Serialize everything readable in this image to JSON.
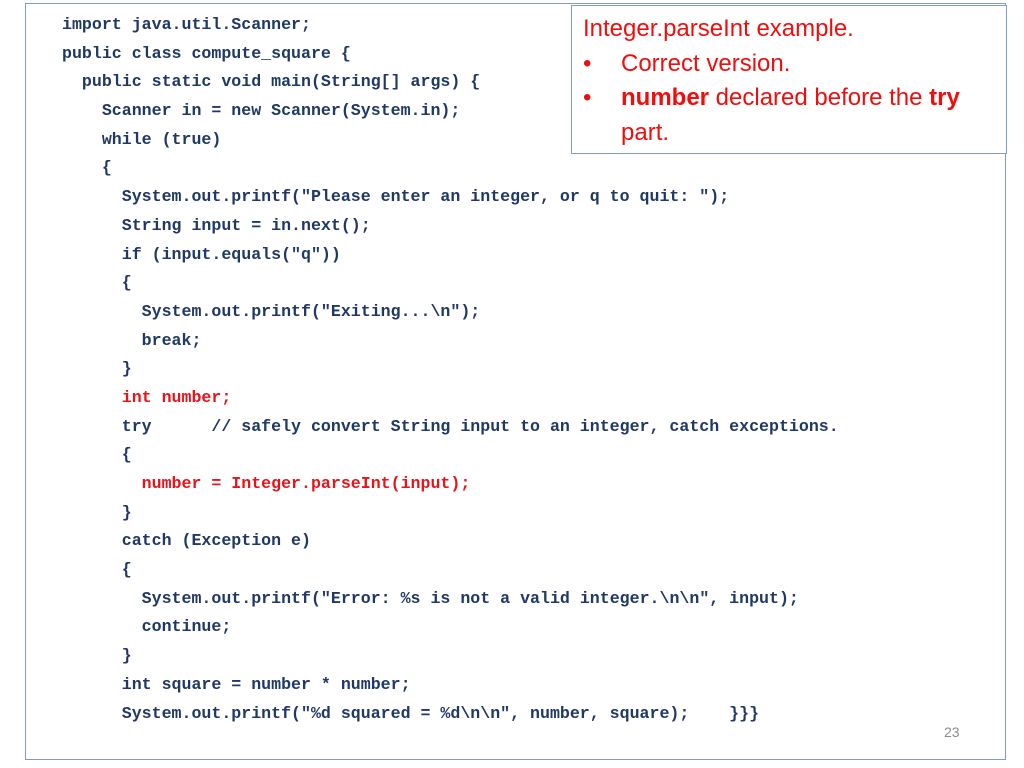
{
  "code": {
    "lines": [
      {
        "indent": "",
        "text": "import java.util.Scanner;",
        "highlight": false
      },
      {
        "indent": "",
        "text": "public class compute_square {",
        "highlight": false
      },
      {
        "indent": "  ",
        "text": "public static void main(String[] args) {",
        "highlight": false
      },
      {
        "indent": "    ",
        "text": "Scanner in = new Scanner(System.in);",
        "highlight": false
      },
      {
        "indent": "    ",
        "text": "while (true)",
        "highlight": false
      },
      {
        "indent": "    ",
        "text": "{",
        "highlight": false
      },
      {
        "indent": "      ",
        "text": "System.out.printf(\"Please enter an integer, or q to quit: \");",
        "highlight": false
      },
      {
        "indent": "      ",
        "text": "String input = in.next();",
        "highlight": false
      },
      {
        "indent": "      ",
        "text": "if (input.equals(\"q\"))",
        "highlight": false
      },
      {
        "indent": "      ",
        "text": "{",
        "highlight": false
      },
      {
        "indent": "        ",
        "text": "System.out.printf(\"Exiting...\\n\");",
        "highlight": false
      },
      {
        "indent": "        ",
        "text": "break;",
        "highlight": false
      },
      {
        "indent": "      ",
        "text": "}",
        "highlight": false
      },
      {
        "indent": "      ",
        "text": "int number;",
        "highlight": true
      },
      {
        "indent": "      ",
        "text": "try      // safely convert String input to an integer, catch exceptions.",
        "highlight": false
      },
      {
        "indent": "      ",
        "text": "{",
        "highlight": false
      },
      {
        "indent": "        ",
        "text": "number = Integer.parseInt(input);",
        "highlight": true
      },
      {
        "indent": "      ",
        "text": "}",
        "highlight": false
      },
      {
        "indent": "      ",
        "text": "catch (Exception e)",
        "highlight": false
      },
      {
        "indent": "      ",
        "text": "{",
        "highlight": false
      },
      {
        "indent": "        ",
        "text": "System.out.printf(\"Error: %s is not a valid integer.\\n\\n\", input);",
        "highlight": false
      },
      {
        "indent": "        ",
        "text": "continue;",
        "highlight": false
      },
      {
        "indent": "      ",
        "text": "}",
        "highlight": false
      },
      {
        "indent": "      ",
        "text": "int square = number * number;",
        "highlight": false
      },
      {
        "indent": "      ",
        "text": "System.out.printf(\"%d squared = %d\\n\\n\", number, square);    }}}",
        "highlight": false
      }
    ]
  },
  "note": {
    "title": "Integer.parseInt example.",
    "bullet_glyph": "•",
    "bullets": [
      {
        "parts": [
          {
            "text": "Correct version.",
            "bold": false
          }
        ]
      },
      {
        "parts": [
          {
            "text": "number",
            "bold": true
          },
          {
            "text": " declared before the ",
            "bold": false
          },
          {
            "text": "try",
            "bold": true
          },
          {
            "text": " part.",
            "bold": false
          }
        ]
      }
    ]
  },
  "page_number": "23",
  "colors": {
    "code_text": "#1f3864",
    "highlight_text": "#e8141b",
    "note_text": "#ef0e0e",
    "box_border": "#7f9cc8"
  }
}
